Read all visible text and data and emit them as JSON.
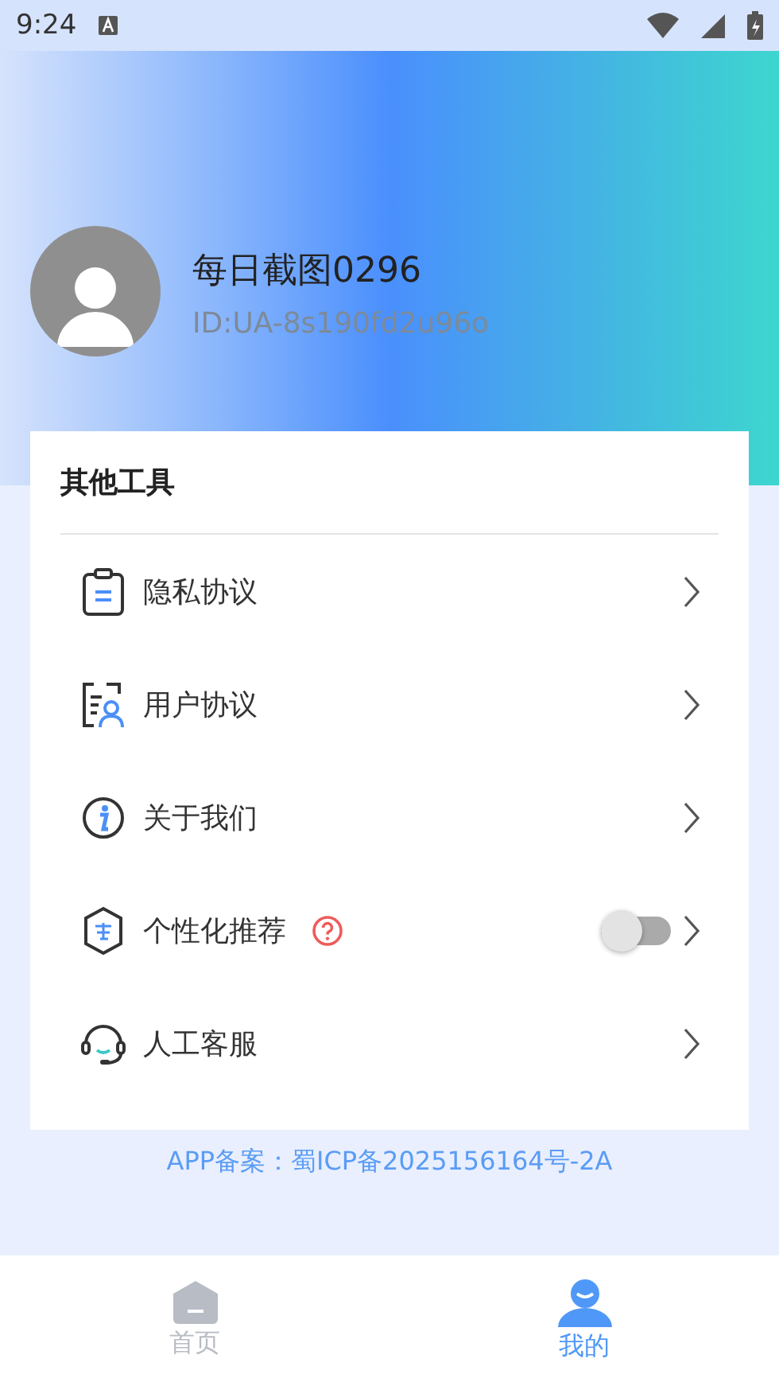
{
  "status_bar": {
    "time": "9:24"
  },
  "profile": {
    "name": "每日截图0296",
    "user_id": "ID:UA-8s190fd2u96o"
  },
  "tools": {
    "title": "其他工具",
    "items": [
      {
        "kind": "link",
        "label": "隐私协议"
      },
      {
        "kind": "link",
        "label": "用户协议"
      },
      {
        "kind": "link",
        "label": "关于我们"
      },
      {
        "kind": "toggle",
        "label": "个性化推荐",
        "on": false
      },
      {
        "kind": "link",
        "label": "人工客服"
      }
    ]
  },
  "footer": "APP备案：蜀ICP备2025156164号-2A",
  "tabs": [
    {
      "label": "首页",
      "selected": false
    },
    {
      "label": "我的",
      "selected": true
    }
  ]
}
